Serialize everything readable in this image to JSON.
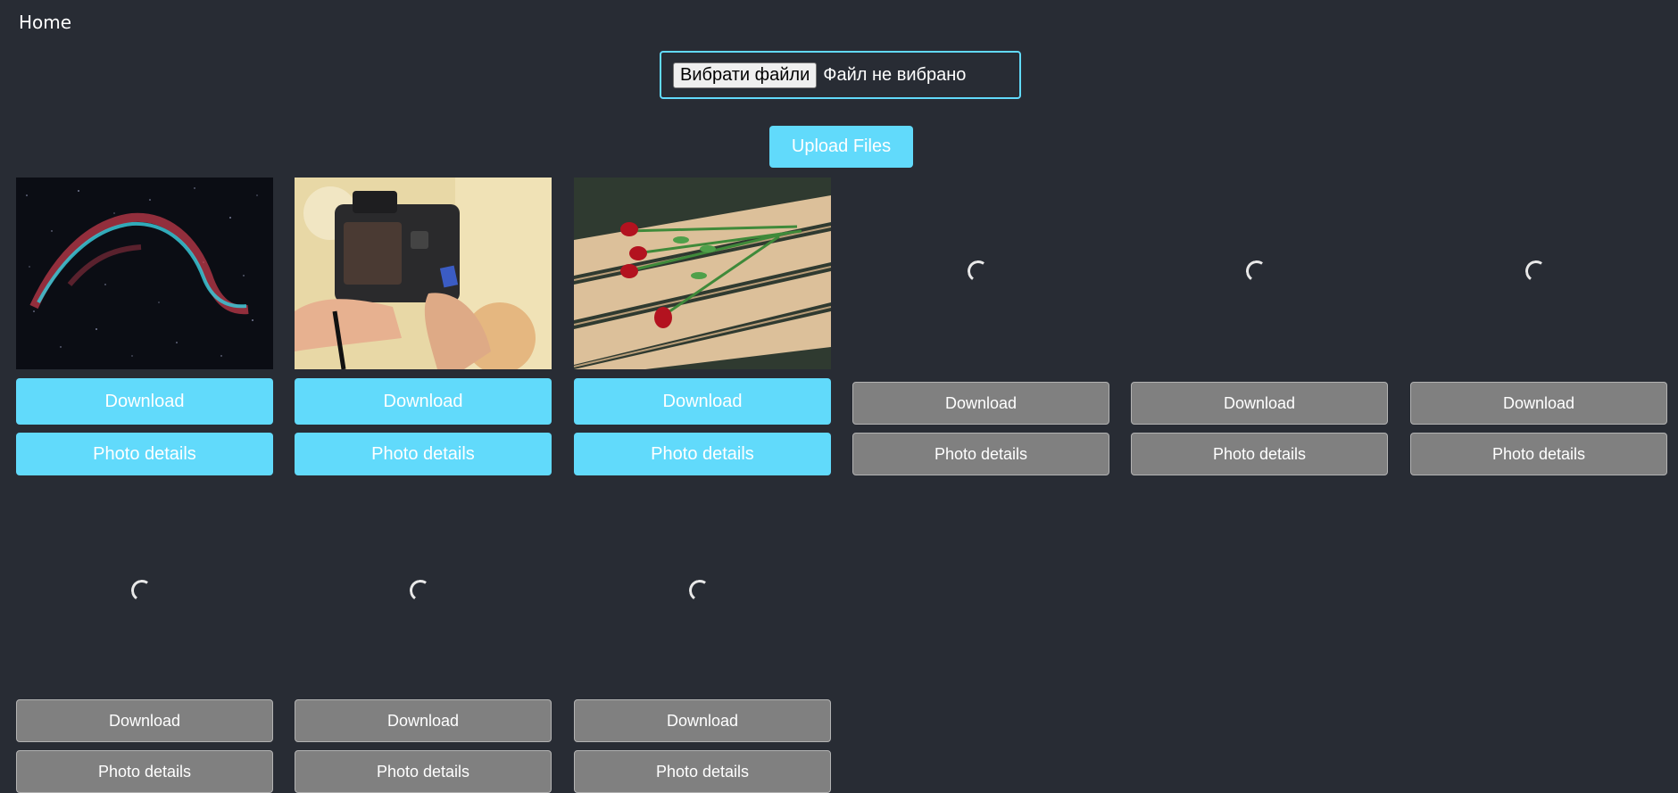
{
  "nav": {
    "home_label": "Home"
  },
  "uploader": {
    "choose_label": "Вибрати файли",
    "no_file_text": "Файл не вибрано",
    "upload_label": "Upload Files"
  },
  "colors": {
    "background": "#282c34",
    "accent": "#61dafb",
    "disabled_button": "#808080"
  },
  "gallery": {
    "download_label": "Download",
    "details_label": "Photo details",
    "photos": [
      {
        "state": "loaded",
        "content": "veil nebula in starry night sky"
      },
      {
        "state": "loaded",
        "content": "hands inserting SD card into camera"
      },
      {
        "state": "loaded",
        "content": "red roses lying on wooden bench"
      },
      {
        "state": "loading"
      },
      {
        "state": "loading"
      },
      {
        "state": "loading"
      },
      {
        "state": "loading"
      },
      {
        "state": "loading"
      },
      {
        "state": "loading"
      }
    ]
  }
}
